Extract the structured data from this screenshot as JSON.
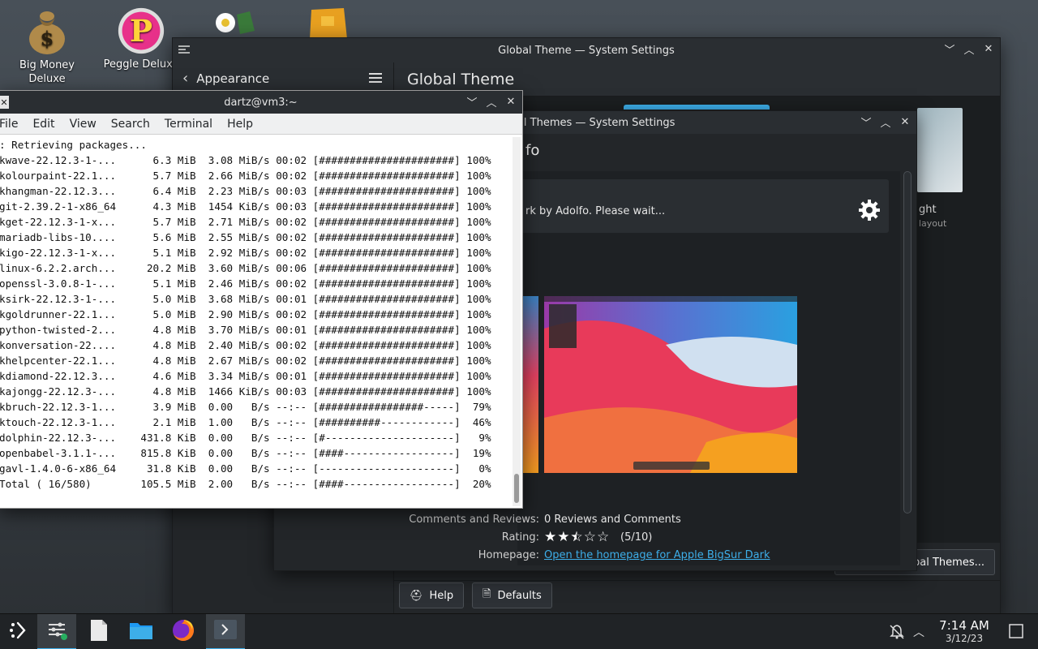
{
  "desktop": {
    "icons": [
      {
        "label": "Big Money Deluxe"
      },
      {
        "label": "Peggle Deluxe"
      }
    ]
  },
  "settings": {
    "title": "Global Theme — System Settings",
    "sidebar_title": "Appearance",
    "page_title": "Global Theme",
    "right_theme_name": "ght",
    "right_theme_sub": "layout",
    "get_new_label": "obal Themes...",
    "help_label": "Help",
    "defaults_label": "Defaults"
  },
  "dialog": {
    "title": "New Global Themes — System Settings",
    "heading": "fo",
    "status": "rk by Adolfo. Please wait...",
    "comments_label": "Comments and Reviews:",
    "comments_value": "0 Reviews and Comments",
    "rating_label": "Rating:",
    "rating_value": "(5/10)",
    "rating_fraction": 0.5,
    "homepage_label": "Homepage:",
    "homepage_link": "Open the homepage for Apple BigSur Dark"
  },
  "terminal": {
    "title": "dartz@vm3:~",
    "menu": [
      "File",
      "Edit",
      "View",
      "Search",
      "Terminal",
      "Help"
    ],
    "lines": [
      ": Retrieving packages...",
      "kwave-22.12.3-1-...      6.3 MiB  3.08 MiB/s 00:02 [######################] 100%",
      "kolourpaint-22.1...      5.7 MiB  2.66 MiB/s 00:02 [######################] 100%",
      "khangman-22.12.3...      6.4 MiB  2.23 MiB/s 00:03 [######################] 100%",
      "git-2.39.2-1-x86_64      4.3 MiB  1454 KiB/s 00:03 [######################] 100%",
      "kget-22.12.3-1-x...      5.7 MiB  2.71 MiB/s 00:02 [######################] 100%",
      "mariadb-libs-10....      5.6 MiB  2.55 MiB/s 00:02 [######################] 100%",
      "kigo-22.12.3-1-x...      5.1 MiB  2.92 MiB/s 00:02 [######################] 100%",
      "linux-6.2.2.arch...     20.2 MiB  3.60 MiB/s 00:06 [######################] 100%",
      "openssl-3.0.8-1-...      5.1 MiB  2.46 MiB/s 00:02 [######################] 100%",
      "ksirk-22.12.3-1-...      5.0 MiB  3.68 MiB/s 00:01 [######################] 100%",
      "kgoldrunner-22.1...      5.0 MiB  2.90 MiB/s 00:02 [######################] 100%",
      "python-twisted-2...      4.8 MiB  3.70 MiB/s 00:01 [######################] 100%",
      "konversation-22....      4.8 MiB  2.40 MiB/s 00:02 [######################] 100%",
      "khelpcenter-22.1...      4.8 MiB  2.67 MiB/s 00:02 [######################] 100%",
      "kdiamond-22.12.3...      4.6 MiB  3.34 MiB/s 00:01 [######################] 100%",
      "kajongg-22.12.3-...      4.8 MiB  1466 KiB/s 00:03 [######################] 100%",
      "kbruch-22.12.3-1...      3.9 MiB  0.00   B/s --:-- [#################-----]  79%",
      "ktouch-22.12.3-1...      2.1 MiB  1.00   B/s --:-- [##########------------]  46%",
      "dolphin-22.12.3-...    431.8 KiB  0.00   B/s --:-- [#---------------------]   9%",
      "openbabel-3.1.1-...    815.8 KiB  0.00   B/s --:-- [####------------------]  19%",
      "gavl-1.4.0-6-x86_64     31.8 KiB  0.00   B/s --:-- [----------------------]   0%",
      "Total ( 16/580)        105.5 MiB  2.00   B/s --:-- [####------------------]  20%"
    ]
  },
  "taskbar": {
    "time": "7:14 AM",
    "date": "3/12/23"
  },
  "colors": {
    "accent": "#3daee9",
    "panel": "#202326",
    "window": "#232629"
  }
}
